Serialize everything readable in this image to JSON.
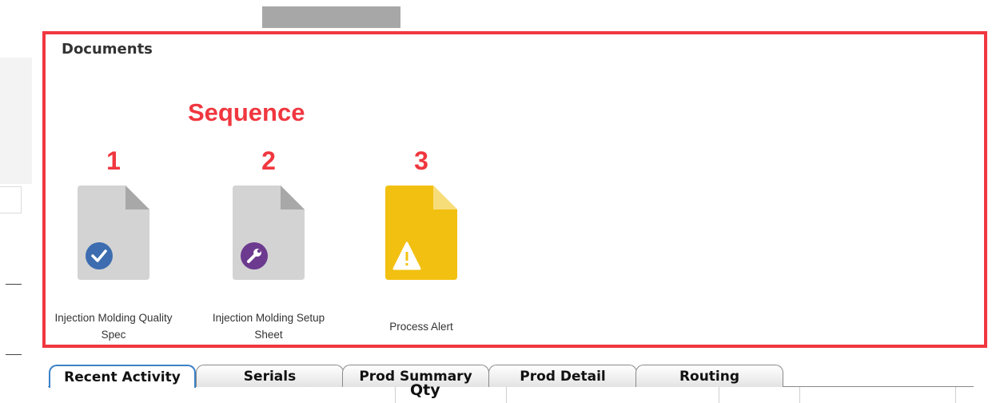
{
  "header": {
    "bar_color": "#a7a7a7"
  },
  "documents": {
    "title": "Documents",
    "sequence_label": "Sequence",
    "highlight_color": "#f0373f",
    "items": [
      {
        "number": "1",
        "label_line1": "Injection Molding Quality",
        "label_line2": "Spec",
        "icon": "document-check-icon",
        "badge_color": "#3d6db0"
      },
      {
        "number": "2",
        "label_line1": "Injection Molding Setup",
        "label_line2": "Sheet",
        "icon": "document-wrench-icon",
        "badge_color": "#6c3a8f"
      },
      {
        "number": "3",
        "label_line1": "Process Alert",
        "label_line2": "",
        "icon": "document-alert-icon",
        "badge_color": "#f2c011"
      }
    ]
  },
  "tabs": {
    "items": [
      {
        "label": "Recent Activity",
        "active": true
      },
      {
        "label": "Serials",
        "active": false
      },
      {
        "label": "Prod Summary",
        "active": false
      },
      {
        "label": "Prod Detail",
        "active": false
      },
      {
        "label": "Routing",
        "active": false
      }
    ],
    "active_color": "#3c82c8"
  },
  "grid": {
    "qty_header": "Qty"
  }
}
